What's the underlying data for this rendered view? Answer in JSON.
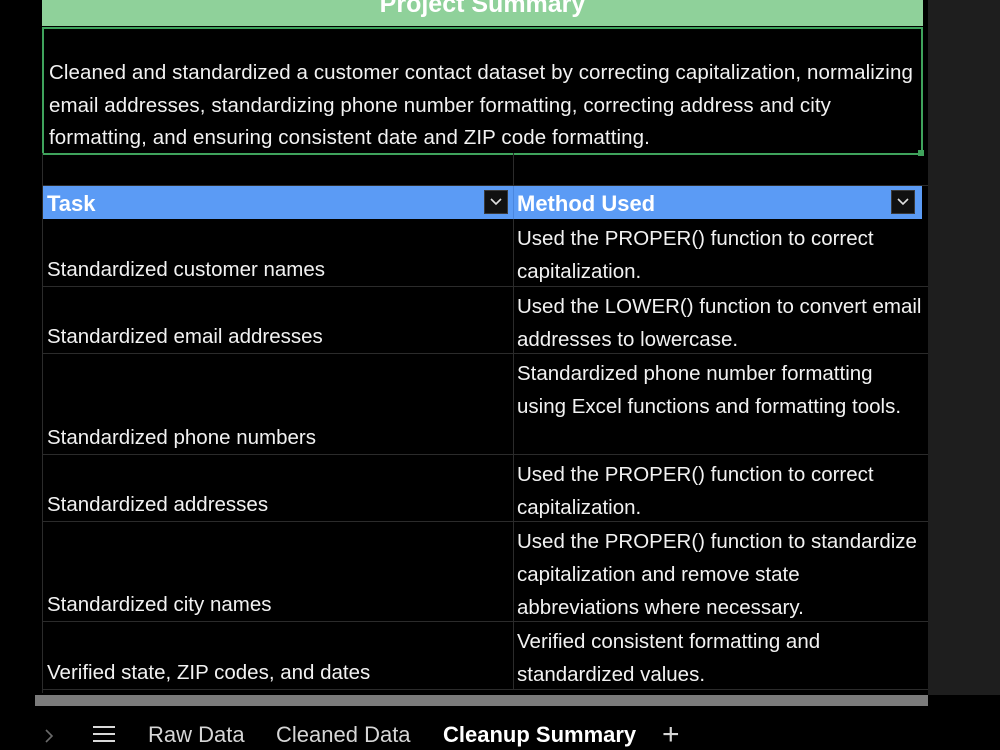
{
  "title": "Project Summary",
  "summary": "Cleaned and standardized a customer contact dataset by correcting capitalization, normalizing email addresses, standardizing phone number formatting, correcting address and city formatting, and ensuring consistent date and ZIP code formatting.",
  "table": {
    "headers": [
      "Task",
      "Method Used"
    ],
    "rows": [
      {
        "task": "Standardized customer names",
        "method": "Used the PROPER() function to correct capitalization."
      },
      {
        "task": "Standardized email addresses",
        "method": "Used the LOWER() function to convert email addresses to lowercase."
      },
      {
        "task": "Standardized phone numbers",
        "method": "Standardized phone number formatting using Excel functions and formatting tools."
      },
      {
        "task": "Standardized addresses",
        "method": "Used the PROPER() function to correct capitalization."
      },
      {
        "task": "Standardized city names",
        "method": "Used the PROPER() function to standardize capitalization and remove state abbreviations where necessary."
      },
      {
        "task": "Verified state, ZIP codes, and dates",
        "method": "Verified consistent formatting and standardized values."
      }
    ]
  },
  "tabs": [
    {
      "label": "Raw Data",
      "active": false
    },
    {
      "label": "Cleaned Data",
      "active": false
    },
    {
      "label": "Cleanup Summary",
      "active": true
    }
  ],
  "icons": {
    "nav": "chevron-right-icon",
    "menu": "hamburger-menu-icon",
    "add": "plus-icon",
    "filter": "filter-dropdown-icon"
  },
  "colors": {
    "title_bg": "#8fd19a",
    "header_bg": "#5b9bf5",
    "selection_border": "#3fa35c"
  }
}
